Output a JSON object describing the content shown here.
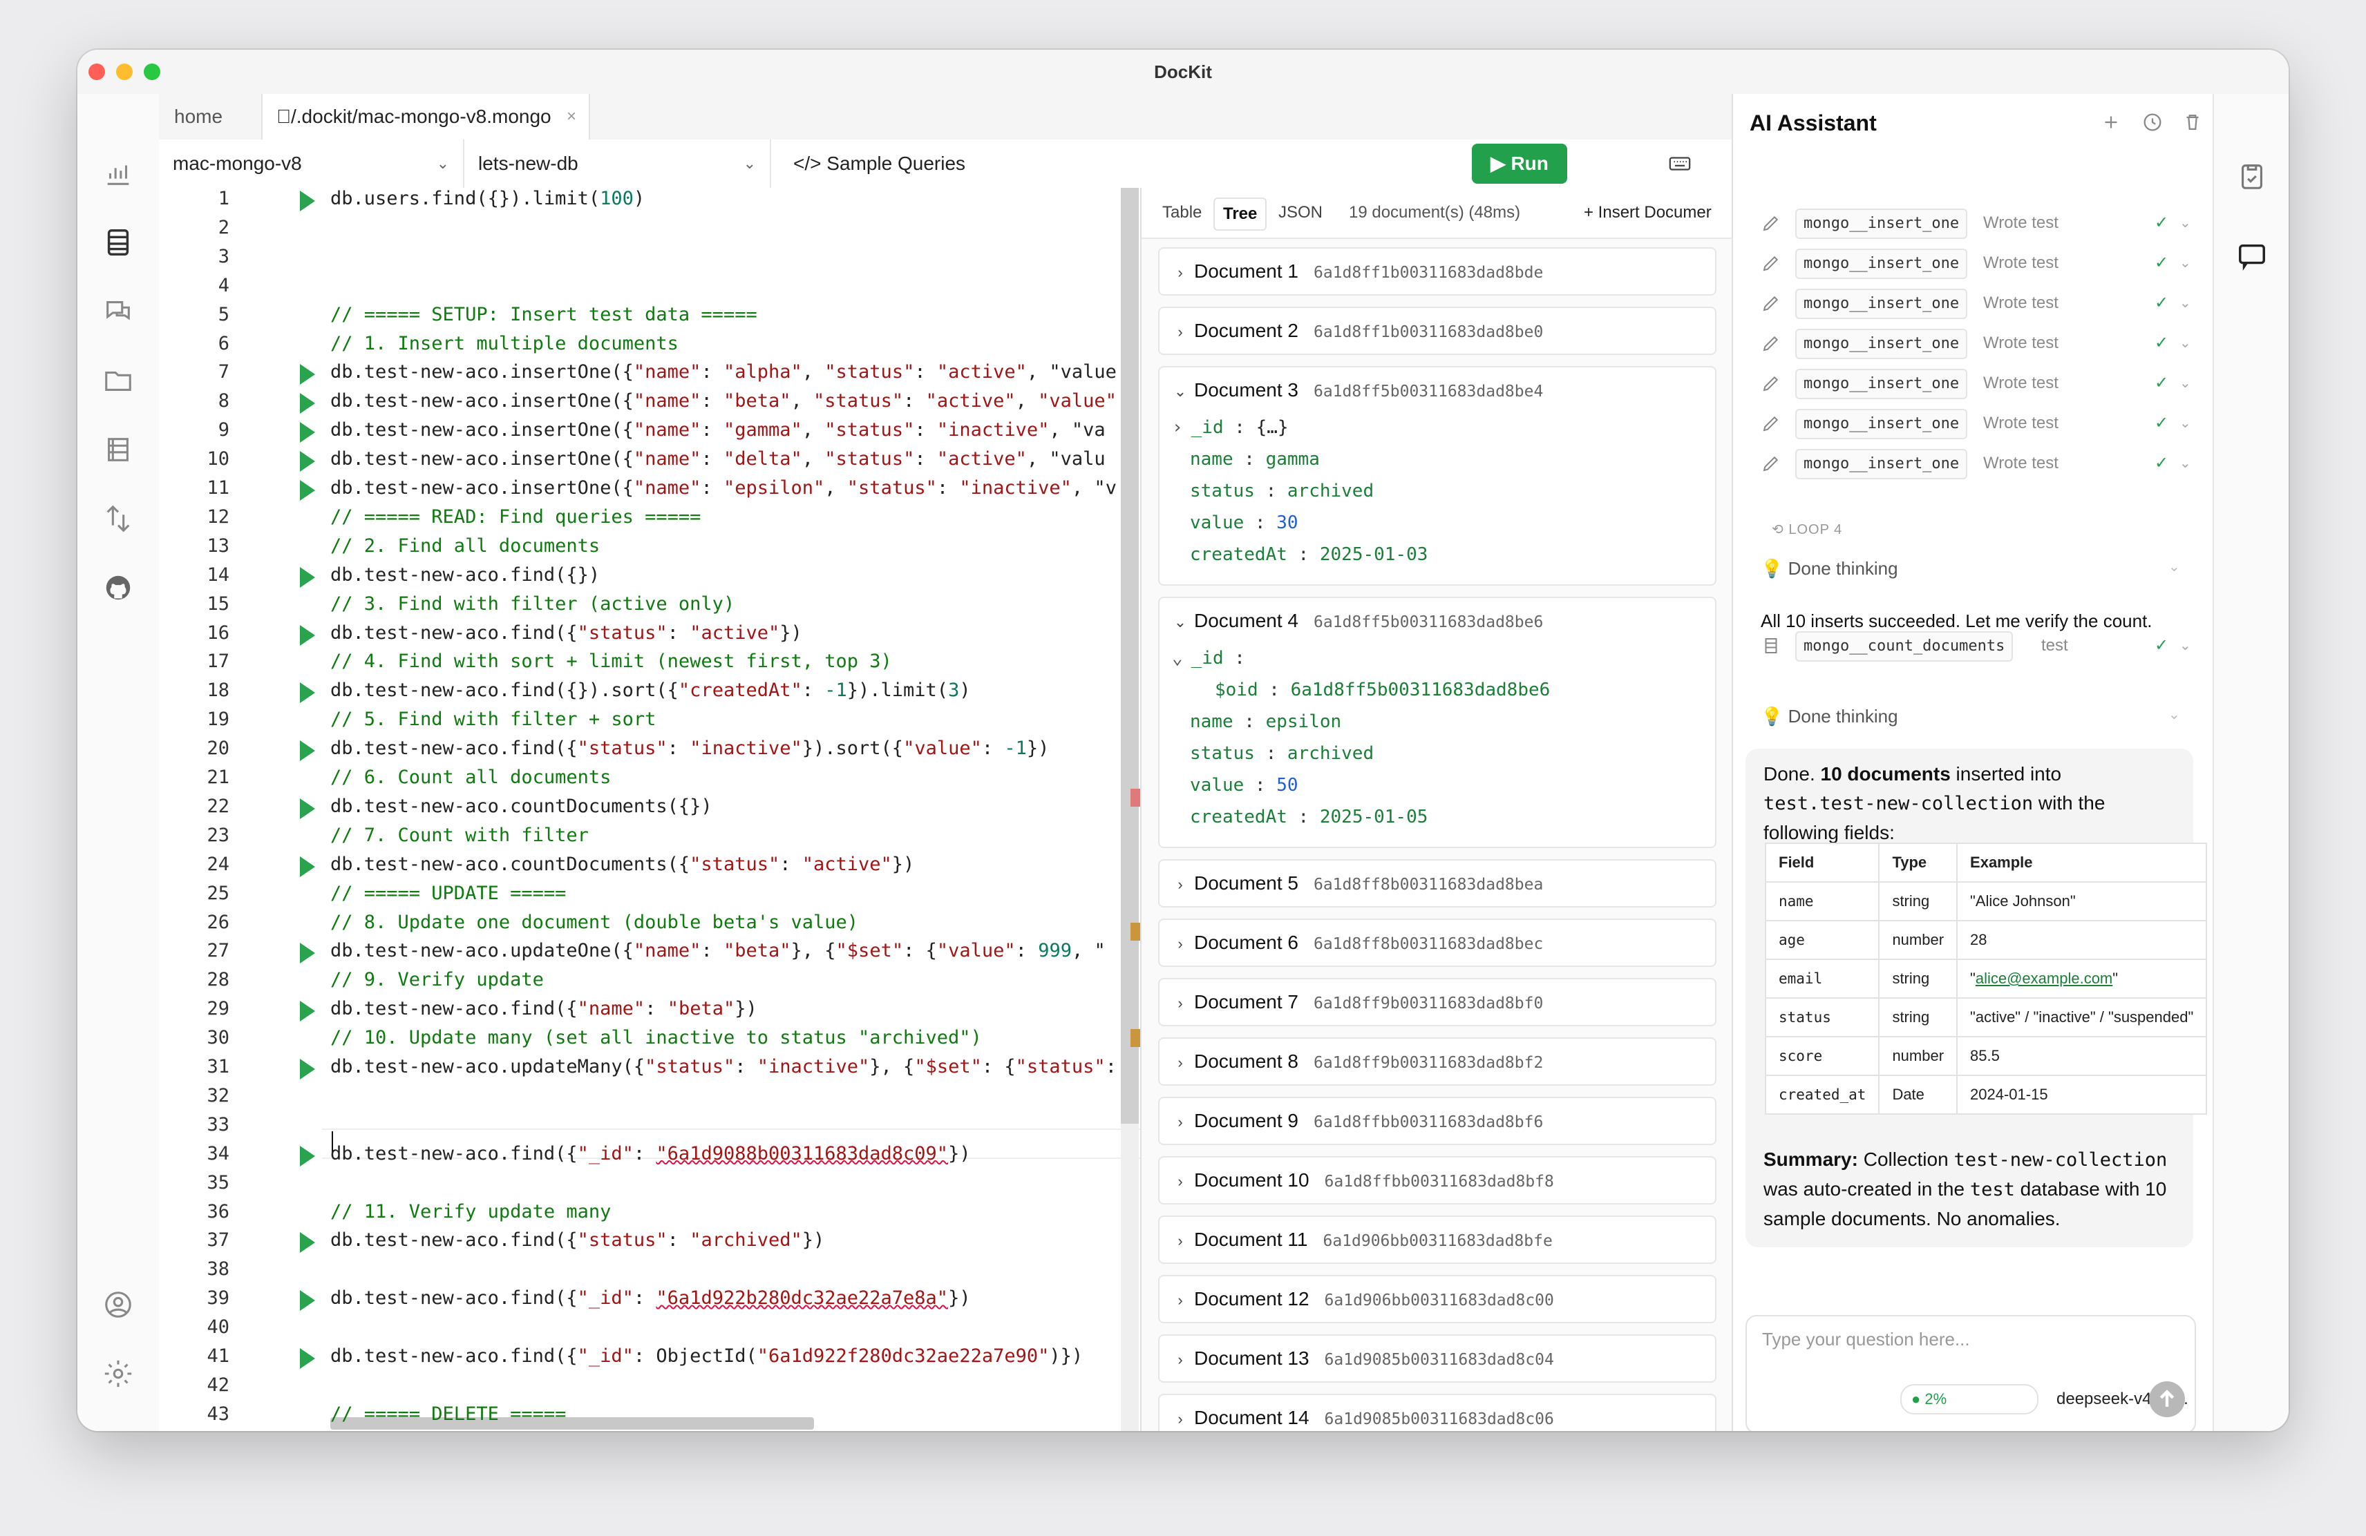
{
  "window": {
    "title": "DocKit"
  },
  "tabs": [
    {
      "label": "home"
    },
    {
      "label": "/.dockit/mac-mongo-v8.mongo",
      "close": "×"
    }
  ],
  "toolbar": {
    "connection": "mac-mongo-v8",
    "database": "lets-new-db",
    "sample_queries": "</> Sample Queries",
    "run": "Run"
  },
  "editor": {
    "cursor_line": 32,
    "lines": [
      "db.users.find({}).limit(100)",
      "",
      "",
      "",
      "// ===== SETUP: Insert test data =====",
      "// 1. Insert multiple documents",
      "db.test-new-aco.insertOne({\"name\": \"alpha\", \"status\": \"active\", \"value",
      "db.test-new-aco.insertOne({\"name\": \"beta\", \"status\": \"active\", \"value\"",
      "db.test-new-aco.insertOne({\"name\": \"gamma\", \"status\": \"inactive\", \"va",
      "db.test-new-aco.insertOne({\"name\": \"delta\", \"status\": \"active\", \"valu",
      "db.test-new-aco.insertOne({\"name\": \"epsilon\", \"status\": \"inactive\", \"v",
      "// ===== READ: Find queries =====",
      "// 2. Find all documents",
      "db.test-new-aco.find({})",
      "// 3. Find with filter (active only)",
      "db.test-new-aco.find({\"status\": \"active\"})",
      "// 4. Find with sort + limit (newest first, top 3)",
      "db.test-new-aco.find({}).sort({\"createdAt\": -1}).limit(3)",
      "// 5. Find with filter + sort",
      "db.test-new-aco.find({\"status\": \"inactive\"}).sort({\"value\": -1})",
      "// 6. Count all documents",
      "db.test-new-aco.countDocuments({})",
      "// 7. Count with filter",
      "db.test-new-aco.countDocuments({\"status\": \"active\"})",
      "// ===== UPDATE =====",
      "// 8. Update one document (double beta's value)",
      "db.test-new-aco.updateOne({\"name\": \"beta\"}, {\"$set\": {\"value\": 999, \"",
      "// 9. Verify update",
      "db.test-new-aco.find({\"name\": \"beta\"})",
      "// 10. Update many (set all inactive to status \"archived\")",
      "db.test-new-aco.updateMany({\"status\": \"inactive\"}, {\"$set\": {\"status\":",
      "",
      "",
      "db.test-new-aco.find({\"_id\": \"6a1d9088b00311683dad8c09\"})",
      "",
      "// 11. Verify update many",
      "db.test-new-aco.find({\"status\": \"archived\"})",
      "",
      "db.test-new-aco.find({\"_id\": \"6a1d922b280dc32ae22a7e8a\"})",
      "",
      "db.test-new-aco.find({\"_id\": ObjectId(\"6a1d922f280dc32ae22a7e90\")})",
      "",
      "// ===== DELETE ====="
    ]
  },
  "results": {
    "tabs": [
      "Table",
      "Tree",
      "JSON"
    ],
    "active_tab": "Tree",
    "count": "19 document(s) (48ms)",
    "insert_label": "+ Insert Documer",
    "documents": [
      {
        "label": "Document 1",
        "id": "6a1d8ff1b00311683dad8bde"
      },
      {
        "label": "Document 2",
        "id": "6a1d8ff1b00311683dad8be0"
      },
      {
        "label": "Document 3",
        "id": "6a1d8ff5b00311683dad8be4",
        "fields": [
          {
            "k": "_id",
            "v": "{…}"
          },
          {
            "k": "name",
            "v": "gamma"
          },
          {
            "k": "status",
            "v": "archived"
          },
          {
            "k": "value",
            "v": "30"
          },
          {
            "k": "createdAt",
            "v": "2025-01-03"
          }
        ]
      },
      {
        "label": "Document 4",
        "id": "6a1d8ff5b00311683dad8be6",
        "fields": [
          {
            "k": "_id",
            "v": ""
          },
          {
            "k": "$oid",
            "v": "6a1d8ff5b00311683dad8be6"
          },
          {
            "k": "name",
            "v": "epsilon"
          },
          {
            "k": "status",
            "v": "archived"
          },
          {
            "k": "value",
            "v": "50"
          },
          {
            "k": "createdAt",
            "v": "2025-01-05"
          }
        ]
      },
      {
        "label": "Document 5",
        "id": "6a1d8ff8b00311683dad8bea"
      },
      {
        "label": "Document 6",
        "id": "6a1d8ff8b00311683dad8bec"
      },
      {
        "label": "Document 7",
        "id": "6a1d8ff9b00311683dad8bf0"
      },
      {
        "label": "Document 8",
        "id": "6a1d8ff9b00311683dad8bf2"
      },
      {
        "label": "Document 9",
        "id": "6a1d8ffbb00311683dad8bf6"
      },
      {
        "label": "Document 10",
        "id": "6a1d8ffbb00311683dad8bf8"
      },
      {
        "label": "Document 11",
        "id": "6a1d906bb00311683dad8bfe"
      },
      {
        "label": "Document 12",
        "id": "6a1d906bb00311683dad8c00"
      },
      {
        "label": "Document 13",
        "id": "6a1d9085b00311683dad8c04"
      },
      {
        "label": "Document 14",
        "id": "6a1d9085b00311683dad8c06"
      }
    ]
  },
  "ai": {
    "title": "AI Assistant",
    "tool_calls": [
      {
        "name": "mongo__insert_one",
        "result": "Wrote test"
      },
      {
        "name": "mongo__insert_one",
        "result": "Wrote test"
      },
      {
        "name": "mongo__insert_one",
        "result": "Wrote test"
      },
      {
        "name": "mongo__insert_one",
        "result": "Wrote test"
      },
      {
        "name": "mongo__insert_one",
        "result": "Wrote test"
      },
      {
        "name": "mongo__insert_one",
        "result": "Wrote test"
      },
      {
        "name": "mongo__insert_one",
        "result": "Wrote test"
      }
    ],
    "loop_label": "LOOP 4",
    "thinking_1": "Done thinking",
    "message": "All 10 inserts succeeded. Let me verify the count.",
    "count_tool": {
      "name": "mongo__count_documents",
      "result": "test"
    },
    "thinking_2": "Done thinking",
    "summary": {
      "intro_1": "Done. ",
      "intro_bold": "10 documents",
      "intro_2": " inserted into ",
      "intro_code": "test.test-new-collection",
      "intro_3": " with the following fields:",
      "table_headers": [
        "Field",
        "Type",
        "Example"
      ],
      "rows": [
        {
          "field": "name",
          "type": "string",
          "example": "\"Alice Johnson\""
        },
        {
          "field": "age",
          "type": "number",
          "example": "28"
        },
        {
          "field": "email",
          "type": "string",
          "example_pre": "\"",
          "example_link": "alice@example.com",
          "example_post": "\""
        },
        {
          "field": "status",
          "type": "string",
          "example": "\"active\" / \"inactive\" / \"suspended\""
        },
        {
          "field": "score",
          "type": "number",
          "example": "85.5"
        },
        {
          "field": "created_at",
          "type": "Date",
          "example": "2024-01-15"
        }
      ],
      "summary_label": "Summary:",
      "summary_1": " Collection ",
      "summary_code1": "test-new-collection",
      "summary_2": " was auto-created in the ",
      "summary_code2": "test",
      "summary_3": " database with 10 sample documents. No anomalies."
    },
    "input_placeholder": "Type your question here...",
    "context_pct": "2%",
    "model": "deepseek-v4-fla..."
  },
  "colors": {
    "accent": "#22a04b",
    "comment": "#0f7a0f",
    "string": "#a31515"
  }
}
